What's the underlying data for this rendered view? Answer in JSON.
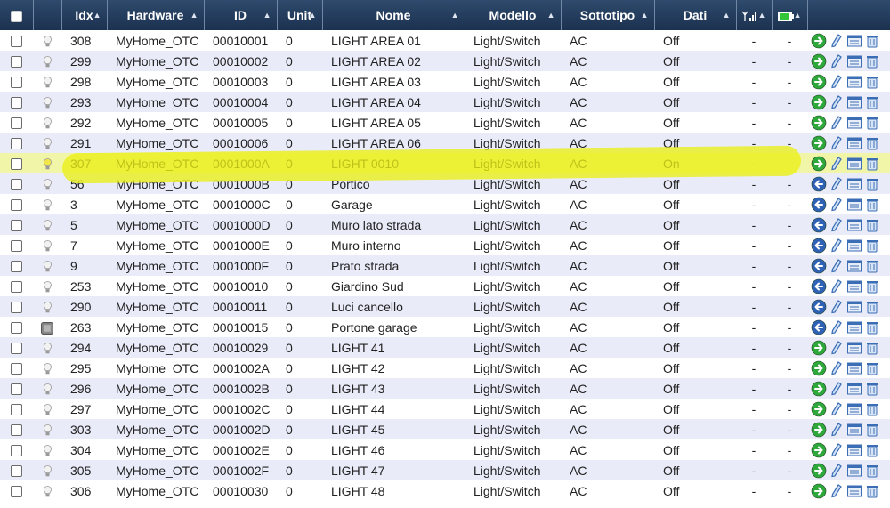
{
  "header": {
    "idx": "Idx",
    "hardware": "Hardware",
    "id": "ID",
    "unit": "Unit",
    "nome": "Nome",
    "modello": "Modello",
    "sottotipo": "Sottotipo",
    "dati": "Dati",
    "signal_icon": "signal-icon",
    "battery_icon": "battery-icon"
  },
  "colors": {
    "header_bg": "#2e4a6c",
    "row_alt": "#e9ebf9",
    "highlight": "#ecf013",
    "green_action": "#2ea83a",
    "blue_action": "#2f62b5"
  },
  "rows": [
    {
      "idx": "308",
      "hw": "MyHome_OTC",
      "id": "00010001",
      "unit": "0",
      "nome": "LIGHT AREA 01",
      "modello": "Light/Switch",
      "sotto": "AC",
      "dati": "Off",
      "sig": "-",
      "bat": "-",
      "state": "off",
      "action": "green"
    },
    {
      "idx": "299",
      "hw": "MyHome_OTC",
      "id": "00010002",
      "unit": "0",
      "nome": "LIGHT AREA 02",
      "modello": "Light/Switch",
      "sotto": "AC",
      "dati": "Off",
      "sig": "-",
      "bat": "-",
      "state": "off",
      "action": "green"
    },
    {
      "idx": "298",
      "hw": "MyHome_OTC",
      "id": "00010003",
      "unit": "0",
      "nome": "LIGHT AREA 03",
      "modello": "Light/Switch",
      "sotto": "AC",
      "dati": "Off",
      "sig": "-",
      "bat": "-",
      "state": "off",
      "action": "green"
    },
    {
      "idx": "293",
      "hw": "MyHome_OTC",
      "id": "00010004",
      "unit": "0",
      "nome": "LIGHT AREA 04",
      "modello": "Light/Switch",
      "sotto": "AC",
      "dati": "Off",
      "sig": "-",
      "bat": "-",
      "state": "off",
      "action": "green"
    },
    {
      "idx": "292",
      "hw": "MyHome_OTC",
      "id": "00010005",
      "unit": "0",
      "nome": "LIGHT AREA 05",
      "modello": "Light/Switch",
      "sotto": "AC",
      "dati": "Off",
      "sig": "-",
      "bat": "-",
      "state": "off",
      "action": "green"
    },
    {
      "idx": "291",
      "hw": "MyHome_OTC",
      "id": "00010006",
      "unit": "0",
      "nome": "LIGHT AREA 06",
      "modello": "Light/Switch",
      "sotto": "AC",
      "dati": "Off",
      "sig": "-",
      "bat": "-",
      "state": "off",
      "action": "green"
    },
    {
      "idx": "307",
      "hw": "MyHome_OTC",
      "id": "0001000A",
      "unit": "0",
      "nome": "LIGHT 0010",
      "modello": "Light/Switch",
      "sotto": "AC",
      "dati": "On",
      "sig": "-",
      "bat": "-",
      "state": "on",
      "action": "green"
    },
    {
      "idx": "56",
      "hw": "MyHome_OTC",
      "id": "0001000B",
      "unit": "0",
      "nome": "Portico",
      "modello": "Light/Switch",
      "sotto": "AC",
      "dati": "Off",
      "sig": "-",
      "bat": "-",
      "state": "off",
      "action": "blue"
    },
    {
      "idx": "3",
      "hw": "MyHome_OTC",
      "id": "0001000C",
      "unit": "0",
      "nome": "Garage",
      "modello": "Light/Switch",
      "sotto": "AC",
      "dati": "Off",
      "sig": "-",
      "bat": "-",
      "state": "off",
      "action": "blue"
    },
    {
      "idx": "5",
      "hw": "MyHome_OTC",
      "id": "0001000D",
      "unit": "0",
      "nome": "Muro lato strada",
      "modello": "Light/Switch",
      "sotto": "AC",
      "dati": "Off",
      "sig": "-",
      "bat": "-",
      "state": "off",
      "action": "blue"
    },
    {
      "idx": "7",
      "hw": "MyHome_OTC",
      "id": "0001000E",
      "unit": "0",
      "nome": "Muro interno",
      "modello": "Light/Switch",
      "sotto": "AC",
      "dati": "Off",
      "sig": "-",
      "bat": "-",
      "state": "off",
      "action": "blue"
    },
    {
      "idx": "9",
      "hw": "MyHome_OTC",
      "id": "0001000F",
      "unit": "0",
      "nome": "Prato strada",
      "modello": "Light/Switch",
      "sotto": "AC",
      "dati": "Off",
      "sig": "-",
      "bat": "-",
      "state": "off",
      "action": "blue"
    },
    {
      "idx": "253",
      "hw": "MyHome_OTC",
      "id": "00010010",
      "unit": "0",
      "nome": "Giardino Sud",
      "modello": "Light/Switch",
      "sotto": "AC",
      "dati": "Off",
      "sig": "-",
      "bat": "-",
      "state": "off",
      "action": "blue"
    },
    {
      "idx": "290",
      "hw": "MyHome_OTC",
      "id": "00010011",
      "unit": "0",
      "nome": "Luci cancello",
      "modello": "Light/Switch",
      "sotto": "AC",
      "dati": "Off",
      "sig": "-",
      "bat": "-",
      "state": "off",
      "action": "blue"
    },
    {
      "idx": "263",
      "hw": "MyHome_OTC",
      "id": "00010015",
      "unit": "0",
      "nome": "Portone garage",
      "modello": "Light/Switch",
      "sotto": "AC",
      "dati": "Off",
      "sig": "-",
      "bat": "-",
      "state": "door",
      "action": "blue"
    },
    {
      "idx": "294",
      "hw": "MyHome_OTC",
      "id": "00010029",
      "unit": "0",
      "nome": "LIGHT 41",
      "modello": "Light/Switch",
      "sotto": "AC",
      "dati": "Off",
      "sig": "-",
      "bat": "-",
      "state": "off",
      "action": "green"
    },
    {
      "idx": "295",
      "hw": "MyHome_OTC",
      "id": "0001002A",
      "unit": "0",
      "nome": "LIGHT 42",
      "modello": "Light/Switch",
      "sotto": "AC",
      "dati": "Off",
      "sig": "-",
      "bat": "-",
      "state": "off",
      "action": "green"
    },
    {
      "idx": "296",
      "hw": "MyHome_OTC",
      "id": "0001002B",
      "unit": "0",
      "nome": "LIGHT 43",
      "modello": "Light/Switch",
      "sotto": "AC",
      "dati": "Off",
      "sig": "-",
      "bat": "-",
      "state": "off",
      "action": "green"
    },
    {
      "idx": "297",
      "hw": "MyHome_OTC",
      "id": "0001002C",
      "unit": "0",
      "nome": "LIGHT 44",
      "modello": "Light/Switch",
      "sotto": "AC",
      "dati": "Off",
      "sig": "-",
      "bat": "-",
      "state": "off",
      "action": "green"
    },
    {
      "idx": "303",
      "hw": "MyHome_OTC",
      "id": "0001002D",
      "unit": "0",
      "nome": "LIGHT 45",
      "modello": "Light/Switch",
      "sotto": "AC",
      "dati": "Off",
      "sig": "-",
      "bat": "-",
      "state": "off",
      "action": "green"
    },
    {
      "idx": "304",
      "hw": "MyHome_OTC",
      "id": "0001002E",
      "unit": "0",
      "nome": "LIGHT 46",
      "modello": "Light/Switch",
      "sotto": "AC",
      "dati": "Off",
      "sig": "-",
      "bat": "-",
      "state": "off",
      "action": "green"
    },
    {
      "idx": "305",
      "hw": "MyHome_OTC",
      "id": "0001002F",
      "unit": "0",
      "nome": "LIGHT 47",
      "modello": "Light/Switch",
      "sotto": "AC",
      "dati": "Off",
      "sig": "-",
      "bat": "-",
      "state": "off",
      "action": "green"
    },
    {
      "idx": "306",
      "hw": "MyHome_OTC",
      "id": "00010030",
      "unit": "0",
      "nome": "LIGHT 48",
      "modello": "Light/Switch",
      "sotto": "AC",
      "dati": "Off",
      "sig": "-",
      "bat": "-",
      "state": "off",
      "action": "green"
    }
  ]
}
